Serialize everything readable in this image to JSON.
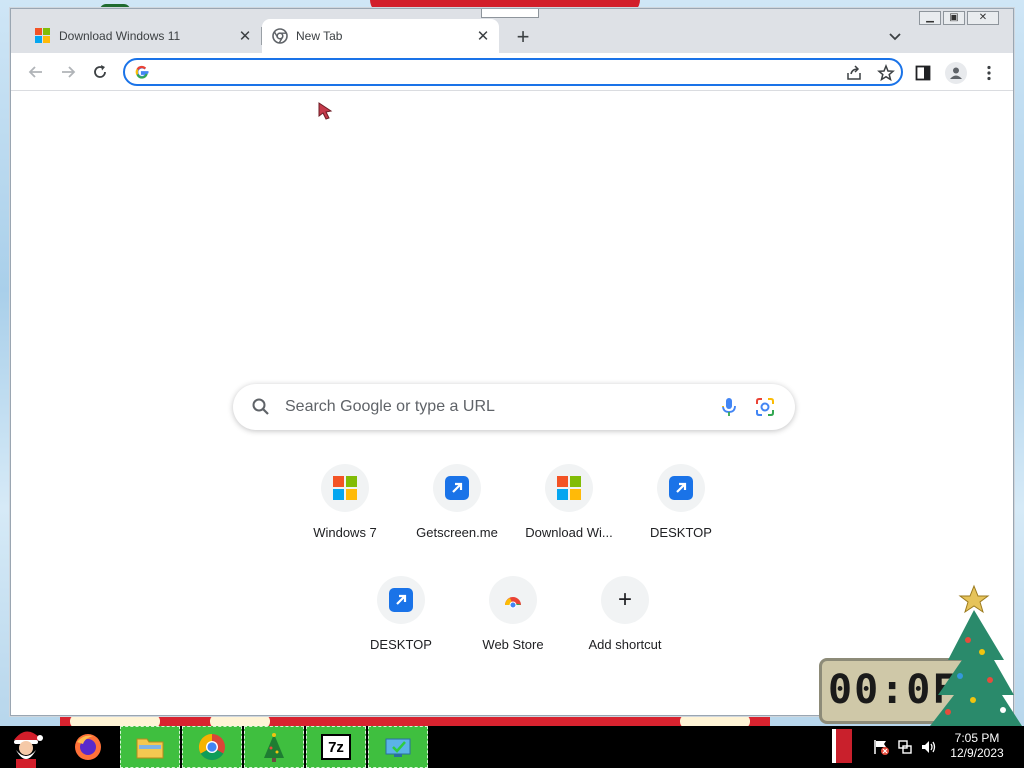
{
  "browser": {
    "tabs": [
      {
        "title": "Download Windows 11",
        "active": false,
        "favicon": "windows-logo-icon"
      },
      {
        "title": "New Tab",
        "active": true,
        "favicon": "chrome-icon"
      }
    ],
    "new_tab_symbol": "+",
    "close_symbol": "✕",
    "omnibox": {
      "value": "",
      "placeholder": ""
    }
  },
  "ntp": {
    "search_placeholder": "Search Google or type a URL",
    "shortcuts": [
      {
        "label": "Windows 7",
        "icon": "windows-logo-icon"
      },
      {
        "label": "Getscreen.me",
        "icon": "shortcut-arrow-icon"
      },
      {
        "label": "Download Wi...",
        "icon": "windows-logo-icon"
      },
      {
        "label": "DESKTOP",
        "icon": "shortcut-arrow-icon"
      },
      {
        "label": "DESKTOP",
        "icon": "shortcut-arrow-icon"
      },
      {
        "label": "Web Store",
        "icon": "chrome-web-store-icon"
      },
      {
        "label": "Add shortcut",
        "icon": "plus-icon"
      }
    ],
    "add_symbol": "+"
  },
  "gadget": {
    "clock_text": "00:0F"
  },
  "taskbar": {
    "apps": [
      "firefox-icon",
      "file-explorer-icon",
      "chrome-icon",
      "christmas-tree-app-icon",
      "7zip-icon",
      "monitor-app-icon"
    ],
    "sevenzip_label": "7z",
    "time": "7:05 PM",
    "date": "12/9/2023"
  },
  "colors": {
    "accent": "#1a73e8",
    "taskbar": "#000000",
    "pinned": "#3fbf3f",
    "tab_strip": "#dee1e6"
  }
}
